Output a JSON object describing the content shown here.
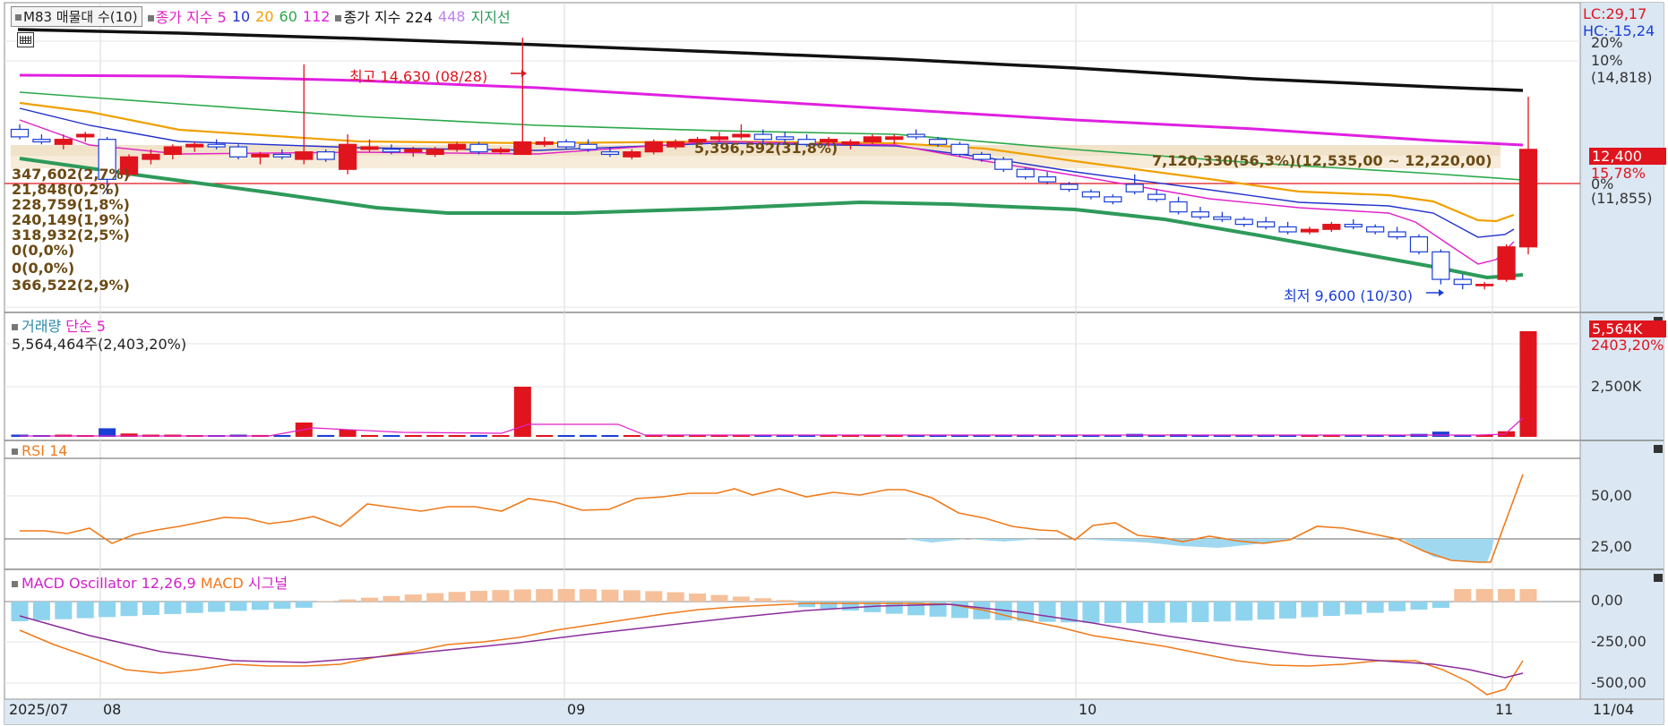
{
  "legend": {
    "indicator_box": "M83 매물대 수(10)",
    "ma_prefix": "종가 지수",
    "ma_5": "5",
    "ma_10": "10",
    "ma_20": "20",
    "ma_60": "60",
    "ma_112": "112",
    "ma224_prefix": "종가 지수 224",
    "ma_448": "448",
    "support": "지지선"
  },
  "price_pane": {
    "high_label": "최고 14,630 (08/28)",
    "low_label": "최저 9,600 (10/30)",
    "band_center_label": "5,396,592(31,8%)",
    "band_right_label": "7,120,330(56,3%)(12,535,00 ~ 12,220,00)",
    "volume_profile": [
      "347,602(2,7%)",
      "21,848(0,2%)",
      "228,759(1,8%)",
      "240,149(1,9%)",
      "318,932(2,5%)",
      "0(0,0%)",
      "0(0,0%)",
      "366,522(2,9%)"
    ],
    "axis": {
      "lc": "LC:29,17",
      "hc": "HC:-15,24",
      "pct20": "20%",
      "pct10": "10%",
      "price_top": "(14,818)",
      "pct0": "0%",
      "price_low": "(11,855)"
    },
    "current_tag": "12,400",
    "current_pct": "15,78%"
  },
  "volume_pane": {
    "title": "거래량",
    "ma_label": "단순 5",
    "value": "5,564,464주(2,403,20%)",
    "tag": "5,564K",
    "tag_pct": "2403,20%",
    "axis_label": "2,500K"
  },
  "rsi_pane": {
    "title": "RSI 14",
    "axis_50": "50,00",
    "axis_25": "25,00"
  },
  "macd_pane": {
    "title": "MACD Oscillator 12,26,9",
    "macd": "MACD",
    "signal": "시그널",
    "axis_0": "0,00",
    "axis_m250": "-250,00",
    "axis_m500": "-500,00"
  },
  "x_axis": {
    "labels": [
      "2025/07",
      "08",
      "09",
      "10",
      "11"
    ],
    "right": "11/04"
  },
  "colors": {
    "up": "#e0141d",
    "down": "#1a3fd6",
    "ma5": "#e020c8",
    "ma10": "#2233cc",
    "ma20": "#f0a000",
    "ma60": "#2aa84a",
    "ma112": "#e020e0",
    "ma224": "#111111",
    "support": "#2e9a5a"
  },
  "chart_data": {
    "type": "candlestick",
    "candles": [
      [
        12800,
        12900,
        12600,
        12650
      ],
      [
        12600,
        12700,
        12500,
        12550
      ],
      [
        12500,
        12700,
        12400,
        12600
      ],
      [
        12650,
        12750,
        12550,
        12700
      ],
      [
        12600,
        12650,
        11500,
        11800
      ],
      [
        11900,
        12300,
        11850,
        12250
      ],
      [
        12200,
        12400,
        12100,
        12300
      ],
      [
        12300,
        12500,
        12200,
        12450
      ],
      [
        12450,
        12550,
        12350,
        12500
      ],
      [
        12500,
        12600,
        12400,
        12450
      ],
      [
        12450,
        12500,
        12200,
        12250
      ],
      [
        12250,
        12350,
        12100,
        12300
      ],
      [
        12300,
        12400,
        12200,
        12250
      ],
      [
        12200,
        14100,
        12100,
        12350
      ],
      [
        12350,
        12400,
        12150,
        12200
      ],
      [
        12000,
        12700,
        11900,
        12500
      ],
      [
        12400,
        12600,
        12350,
        12450
      ],
      [
        12400,
        12500,
        12300,
        12350
      ],
      [
        12350,
        12450,
        12250,
        12400
      ],
      [
        12300,
        12450,
        12250,
        12400
      ],
      [
        12400,
        12550,
        12350,
        12500
      ],
      [
        12500,
        12550,
        12300,
        12350
      ],
      [
        12350,
        12450,
        12300,
        12400
      ],
      [
        12300,
        14630,
        12300,
        12550
      ],
      [
        12500,
        12650,
        12450,
        12550
      ],
      [
        12550,
        12600,
        12400,
        12450
      ],
      [
        12500,
        12600,
        12350,
        12400
      ],
      [
        12350,
        12450,
        12250,
        12300
      ],
      [
        12250,
        12400,
        12200,
        12350
      ],
      [
        12350,
        12600,
        12300,
        12550
      ],
      [
        12450,
        12600,
        12400,
        12550
      ],
      [
        12550,
        12650,
        12450,
        12600
      ],
      [
        12600,
        12750,
        12550,
        12650
      ],
      [
        12650,
        12900,
        12600,
        12700
      ],
      [
        12700,
        12800,
        12500,
        12600
      ],
      [
        12650,
        12750,
        12500,
        12600
      ],
      [
        12600,
        12700,
        12450,
        12500
      ],
      [
        12550,
        12650,
        12450,
        12600
      ],
      [
        12500,
        12600,
        12400,
        12550
      ],
      [
        12550,
        12700,
        12500,
        12650
      ],
      [
        12600,
        12700,
        12500,
        12650
      ],
      [
        12700,
        12800,
        12600,
        12650
      ],
      [
        12600,
        12650,
        12450,
        12500
      ],
      [
        12500,
        12550,
        12250,
        12300
      ],
      [
        12300,
        12350,
        12150,
        12200
      ],
      [
        12200,
        12250,
        11950,
        12000
      ],
      [
        12000,
        12050,
        11800,
        11850
      ],
      [
        11850,
        11950,
        11700,
        11750
      ],
      [
        11700,
        11750,
        11550,
        11600
      ],
      [
        11550,
        11600,
        11400,
        11450
      ],
      [
        11450,
        11500,
        11300,
        11350
      ],
      [
        11700,
        11900,
        11500,
        11550
      ],
      [
        11500,
        11600,
        11350,
        11400
      ],
      [
        11350,
        11450,
        11100,
        11150
      ],
      [
        11150,
        11250,
        11000,
        11050
      ],
      [
        11050,
        11150,
        10950,
        11000
      ],
      [
        11000,
        11050,
        10850,
        10900
      ],
      [
        10950,
        11050,
        10800,
        10850
      ],
      [
        10850,
        10950,
        10700,
        10750
      ],
      [
        10750,
        10850,
        10700,
        10800
      ],
      [
        10800,
        10950,
        10750,
        10900
      ],
      [
        10900,
        11000,
        10800,
        10850
      ],
      [
        10850,
        10900,
        10700,
        10750
      ],
      [
        10750,
        10850,
        10600,
        10650
      ],
      [
        10650,
        10700,
        10300,
        10350
      ],
      [
        10350,
        10400,
        9700,
        9800
      ],
      [
        9800,
        9900,
        9600,
        9700
      ],
      [
        9700,
        9750,
        9600,
        9700
      ],
      [
        9800,
        10500,
        9750,
        10450
      ],
      [
        10450,
        13450,
        10300,
        12400
      ]
    ],
    "ylim": [
      9300,
      14850
    ]
  }
}
